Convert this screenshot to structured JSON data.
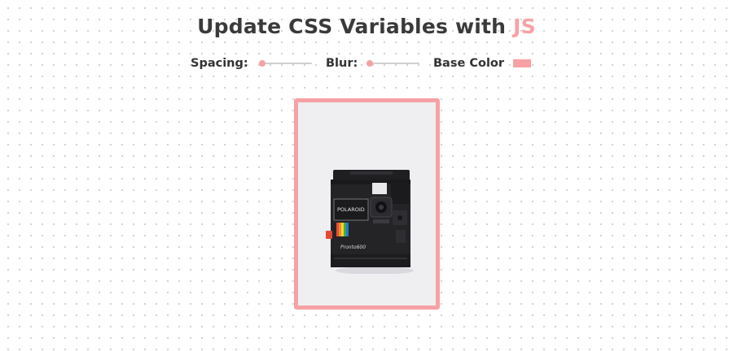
{
  "header": {
    "title_main": "Update CSS Variables with ",
    "title_highlight": "JS"
  },
  "controls": {
    "spacing_label": "Spacing:",
    "spacing_value_fraction": 0.0,
    "blur_label": "Blur:",
    "blur_value_fraction": 0.0,
    "base_color_label": "Base Color",
    "base_color_value": "#f7a1a4"
  },
  "image": {
    "description_icon": "polaroid-camera-photo",
    "brand_text": "POLAROID",
    "model_text": "Pronto600"
  },
  "colors": {
    "accent": "#f7a1a4",
    "text": "#333333",
    "photo_background": "#efeff1"
  }
}
